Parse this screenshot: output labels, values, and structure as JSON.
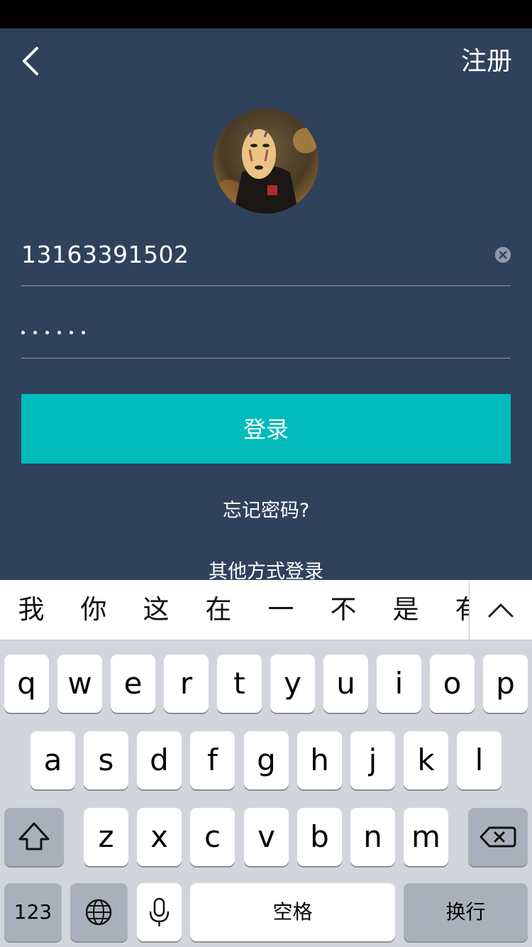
{
  "nav": {
    "register_label": "注册"
  },
  "form": {
    "phone_value": "13163391502",
    "password_dot_count": 6,
    "login_label": "登录",
    "forgot_label": "忘记密码?",
    "other_login_label": "其他方式登录"
  },
  "keyboard": {
    "candidates": [
      "我",
      "你",
      "这",
      "在",
      "一",
      "不",
      "是",
      "有"
    ],
    "row1": [
      "q",
      "w",
      "e",
      "r",
      "t",
      "y",
      "u",
      "i",
      "o",
      "p"
    ],
    "row2": [
      "a",
      "s",
      "d",
      "f",
      "g",
      "h",
      "j",
      "k",
      "l"
    ],
    "row3": [
      "z",
      "x",
      "c",
      "v",
      "b",
      "n",
      "m"
    ],
    "numbers_label": "123",
    "space_label": "空格",
    "return_label": "换行"
  },
  "colors": {
    "background": "#30425b",
    "accent": "#02bbbb"
  }
}
